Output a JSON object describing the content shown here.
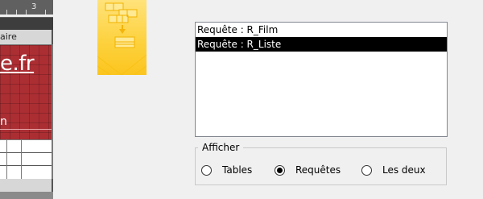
{
  "background_window": {
    "ruler_number": "3",
    "section_label": "aire",
    "site_text": "e.fr",
    "small_text": "n"
  },
  "query_list": {
    "items": [
      {
        "label": "Requête : R_Film",
        "selected": false
      },
      {
        "label": "Requête : R_Liste",
        "selected": true
      }
    ]
  },
  "display_group": {
    "legend": "Afficher",
    "options": [
      {
        "label": "Tables",
        "checked": false
      },
      {
        "label": "Requêtes",
        "checked": true
      },
      {
        "label": "Les deux",
        "checked": false
      }
    ]
  },
  "colors": {
    "selection": "#000000",
    "wizard_yellow": "#fdd23f",
    "background_red": "#ab2e33"
  }
}
